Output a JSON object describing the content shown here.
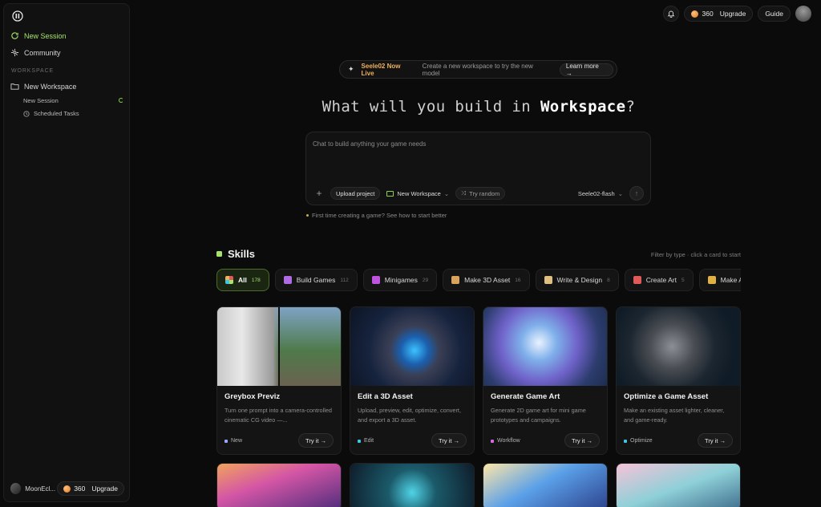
{
  "sidebar": {
    "new_session": "New Session",
    "community": "Community",
    "section_heading": "WORKSPACE",
    "workspace_name": "New Workspace",
    "sub_items": [
      "New Session",
      "Scheduled Tasks"
    ],
    "user_name": "MoonEcl...",
    "credits": "360",
    "upgrade": "Upgrade"
  },
  "topbar": {
    "credits": "360",
    "upgrade": "Upgrade",
    "guide": "Guide"
  },
  "announcement": {
    "live": "Seele02 Now Live",
    "message": "Create a new workspace to try the new model",
    "learn_more": "Learn more →"
  },
  "headline": {
    "prefix": "What will you build in ",
    "emphasis": "Workspace",
    "suffix": "?"
  },
  "chat": {
    "placeholder": "Chat to build anything your game needs",
    "upload": "Upload project",
    "workspace": "New Workspace",
    "try_random": "Try random",
    "model": "Seele02-flash",
    "hint": "First time creating a game? See how to start better"
  },
  "skills": {
    "title": "Skills",
    "filter_note": "Filter by type · click a card to start",
    "tabs": [
      {
        "label": "All",
        "count": "178",
        "color": "#a6e36b"
      },
      {
        "label": "Build Games",
        "count": "112",
        "color": "#b06be3"
      },
      {
        "label": "Minigames",
        "count": "29",
        "color": "#c052e0"
      },
      {
        "label": "Make 3D Asset",
        "count": "16",
        "color": "#d9a35c"
      },
      {
        "label": "Write & Design",
        "count": "8",
        "color": "#e0c080"
      },
      {
        "label": "Create Art",
        "count": "5",
        "color": "#e05a5a"
      },
      {
        "label": "Make A",
        "count": "",
        "color": "#e0b040"
      }
    ],
    "cards": [
      {
        "title": "Greybox Previz",
        "desc": "Turn one prompt into a camera-controlled cinematic CG video —...",
        "tag": "New",
        "tag_color": "#9aa6ff",
        "try": "Try it →"
      },
      {
        "title": "Edit a 3D Asset",
        "desc": "Upload, preview, edit, optimize, convert, and export a 3D asset.",
        "tag": "Edit",
        "tag_color": "#3fc6e0",
        "try": "Try it →"
      },
      {
        "title": "Generate Game Art",
        "desc": "Generate 2D game art for mini game prototypes and campaigns.",
        "tag": "Workflow",
        "tag_color": "#d46bd9",
        "try": "Try it →"
      },
      {
        "title": "Optimize a Game Asset",
        "desc": "Make an existing asset lighter, cleaner, and game-ready.",
        "tag": "Optimize",
        "tag_color": "#3fc6e0",
        "try": "Try it →"
      }
    ]
  }
}
